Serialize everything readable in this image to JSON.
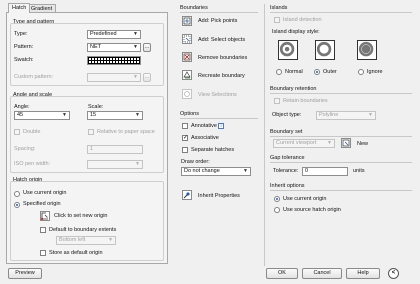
{
  "tabs": [
    {
      "label": "Hatch"
    },
    {
      "label": "Gradient"
    }
  ],
  "type_and_pattern": {
    "title": "Type and pattern",
    "type_label": "Type:",
    "type_value": "Predefined",
    "pattern_label": "Pattern:",
    "pattern_value": "NET",
    "swatch_label": "Swatch:",
    "custom_label": "Custom pattern:",
    "more_button": "..."
  },
  "angle_and_scale": {
    "title": "Angle and scale",
    "angle_label": "Angle:",
    "angle_value": "45",
    "scale_label": "Scale:",
    "scale_value": "15",
    "double_label": "Double",
    "relative_label": "Relative to paper space",
    "spacing_label": "Spacing:",
    "spacing_value": "1",
    "iso_label": "ISO pen width:"
  },
  "hatch_origin": {
    "title": "Hatch origin",
    "use_current_label": "Use current origin",
    "specified_label": "Specified origin",
    "click_set_label": "Click to set new origin",
    "default_extents_label": "Default to boundary extents",
    "extents_value": "Bottom left",
    "store_default_label": "Store as default origin"
  },
  "boundaries": {
    "title": "Boundaries",
    "add_pick_label": "Add: Pick points",
    "add_select_label": "Add: Select objects",
    "remove_label": "Remove boundaries",
    "recreate_label": "Recreate boundary",
    "view_label": "View Selections"
  },
  "options": {
    "title": "Options",
    "annotative_label": "Annotative",
    "info_glyph": "i",
    "associative_label": "Associative",
    "separate_label": "Separate hatches",
    "draw_order_label": "Draw order:",
    "draw_order_value": "Do not change"
  },
  "inherit_label": "Inherit Properties",
  "islands": {
    "title": "Islands",
    "detection_label": "Island detection",
    "style_label": "Island display style:",
    "normal_label": "Normal",
    "outer_label": "Outer",
    "ignore_label": "Ignore"
  },
  "boundary_retention": {
    "title": "Boundary retention",
    "retain_label": "Retain boundaries",
    "object_type_label": "Object type:",
    "object_type_value": "Polyline"
  },
  "boundary_set": {
    "title": "Boundary set",
    "value": "Current viewport",
    "new_label": "New"
  },
  "gap_tolerance": {
    "title": "Gap tolerance",
    "tolerance_label": "Tolerance:",
    "tolerance_value": "0",
    "units_label": "units"
  },
  "inherit_options": {
    "title": "Inherit options",
    "use_current_label": "Use current origin",
    "use_source_label": "Use source hatch origin"
  },
  "footer": {
    "preview_label": "Preview",
    "ok_label": "OK",
    "cancel_label": "Cancel",
    "help_label": "Help",
    "collapse_glyph": "<"
  }
}
